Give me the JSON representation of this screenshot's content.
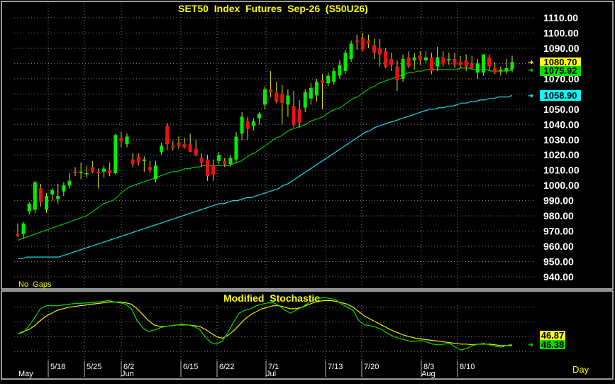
{
  "colors": {
    "background": "#000000",
    "grid": "#808080",
    "axis_text": "#ffffff",
    "title": "#ffff00",
    "up_candle": "#00ee00",
    "down_candle": "#ee1111",
    "ma_short": "#00c000",
    "ma_long": "#20d8e8",
    "stoch_k": "#00dd00",
    "stoch_d": "#eeee00",
    "last_price_tag": "#ffff00",
    "ma_short_tag": "#00dd00",
    "ma_long_tag": "#00ffff"
  },
  "chart_data": [
    {
      "type": "candlestick",
      "title": "SET50  Index  Futures  Sep-26  (S50U26)",
      "corner_note": "No  Gaps",
      "ylim": [
        934,
        1114
      ],
      "y_ticks": [
        940,
        950,
        960,
        970,
        980,
        990,
        1000,
        1010,
        1020,
        1030,
        1040,
        1050,
        1060,
        1070,
        1080,
        1090,
        1100,
        1110
      ],
      "y_tick_labels": [
        "940.00",
        "950.00",
        "960.00",
        "970.00",
        "980.00",
        "990.00",
        "1000.00",
        "1010.00",
        "1020.00",
        "1030.00",
        "1040.00",
        "1050.00",
        "1060.00",
        "1070.00",
        "1080.00",
        "1090.00",
        "1100.00",
        "1110.00"
      ],
      "candles": [
        [
          968,
          975,
          966,
          967
        ],
        [
          968,
          976,
          965,
          975
        ],
        [
          983,
          989,
          981,
          988
        ],
        [
          984,
          1003,
          982,
          1002
        ],
        [
          998,
          1001,
          986,
          989
        ],
        [
          984,
          995,
          982,
          993
        ],
        [
          994,
          998,
          990,
          997
        ],
        [
          991,
          1001,
          988,
          993
        ],
        [
          996,
          1002,
          993,
          1000
        ],
        [
          1000,
          1008,
          998,
          1003
        ],
        [
          1009,
          1012,
          1006,
          1008
        ],
        [
          1008,
          1015,
          1004,
          1009
        ],
        [
          1008,
          1013,
          1005,
          1008
        ],
        [
          1012,
          1016,
          1008,
          1009
        ],
        [
          1009,
          1011,
          998,
          1008
        ],
        [
          1009,
          1013,
          1005,
          1011
        ],
        [
          1010,
          1015,
          1006,
          1008
        ],
        [
          1008,
          1034,
          1007,
          1033
        ],
        [
          1031,
          1035,
          1025,
          1029
        ],
        [
          1027,
          1034,
          1025,
          1032
        ],
        [
          1017,
          1021,
          1012,
          1014
        ],
        [
          1019,
          1021,
          1013,
          1015
        ],
        [
          1016,
          1019,
          1009,
          1017
        ],
        [
          1012,
          1016,
          1008,
          1010
        ],
        [
          1004,
          1016,
          1002,
          1013
        ],
        [
          1022,
          1028,
          1020,
          1026
        ],
        [
          1039,
          1041,
          1023,
          1027
        ],
        [
          1026,
          1029,
          1023,
          1025
        ],
        [
          1028,
          1032,
          1024,
          1026
        ],
        [
          1027,
          1031,
          1024,
          1025
        ],
        [
          1027,
          1034,
          1022,
          1022
        ],
        [
          1024,
          1030,
          1019,
          1020
        ],
        [
          1018,
          1021,
          1012,
          1015
        ],
        [
          1017,
          1020,
          1003,
          1006
        ],
        [
          1013,
          1017,
          1003,
          1007
        ],
        [
          1016,
          1022,
          1014,
          1020
        ],
        [
          1016,
          1018,
          1012,
          1014
        ],
        [
          1014,
          1020,
          1012,
          1018
        ],
        [
          1017,
          1035,
          1015,
          1032
        ],
        [
          1034,
          1048,
          1030,
          1045
        ],
        [
          1042,
          1045,
          1030,
          1037
        ],
        [
          1039,
          1044,
          1036,
          1042
        ],
        [
          1044,
          1048,
          1040,
          1047
        ],
        [
          1053,
          1065,
          1050,
          1063
        ],
        [
          1063,
          1075,
          1058,
          1061
        ],
        [
          1061,
          1068,
          1054,
          1055
        ],
        [
          1060,
          1066,
          1040,
          1054
        ],
        [
          1053,
          1063,
          1045,
          1059
        ],
        [
          1052,
          1062,
          1038,
          1040
        ],
        [
          1050,
          1056,
          1038,
          1041
        ],
        [
          1051,
          1063,
          1048,
          1061
        ],
        [
          1057,
          1067,
          1053,
          1064
        ],
        [
          1059,
          1070,
          1055,
          1068
        ],
        [
          1069,
          1073,
          1050,
          1067
        ],
        [
          1067,
          1074,
          1065,
          1072
        ],
        [
          1068,
          1077,
          1066,
          1075
        ],
        [
          1072,
          1082,
          1070,
          1079
        ],
        [
          1075,
          1089,
          1073,
          1087
        ],
        [
          1083,
          1095,
          1081,
          1093
        ],
        [
          1095,
          1099,
          1089,
          1094
        ],
        [
          1097,
          1100,
          1088,
          1089
        ],
        [
          1095,
          1099,
          1090,
          1093
        ],
        [
          1092,
          1096,
          1083,
          1087
        ],
        [
          1090,
          1096,
          1078,
          1086
        ],
        [
          1088,
          1090,
          1077,
          1078
        ],
        [
          1083,
          1087,
          1075,
          1079
        ],
        [
          1078,
          1082,
          1062,
          1069
        ],
        [
          1070,
          1086,
          1068,
          1083
        ],
        [
          1084,
          1088,
          1077,
          1078
        ],
        [
          1082,
          1087,
          1076,
          1084
        ],
        [
          1085,
          1088,
          1079,
          1082
        ],
        [
          1082,
          1088,
          1080,
          1084
        ],
        [
          1084,
          1087,
          1073,
          1075
        ],
        [
          1078,
          1091,
          1075,
          1084
        ],
        [
          1084,
          1088,
          1078,
          1080
        ],
        [
          1082,
          1087,
          1079,
          1083
        ],
        [
          1083,
          1087,
          1077,
          1079
        ],
        [
          1081,
          1085,
          1077,
          1079
        ],
        [
          1082,
          1086,
          1075,
          1078
        ],
        [
          1080,
          1085,
          1076,
          1077
        ],
        [
          1074,
          1083,
          1070,
          1080
        ],
        [
          1074,
          1086,
          1072,
          1086
        ],
        [
          1084,
          1086,
          1075,
          1078
        ],
        [
          1077,
          1081,
          1073,
          1074
        ],
        [
          1075,
          1078,
          1072,
          1076
        ],
        [
          1075,
          1083,
          1073,
          1077
        ],
        [
          1076,
          1085,
          1074,
          1081
        ]
      ],
      "ma_short": [
        964,
        965,
        966,
        967,
        968,
        969,
        970,
        971,
        972,
        973,
        974,
        975,
        976,
        977,
        978,
        979,
        980,
        982,
        984,
        986,
        988,
        989,
        990,
        992,
        995,
        997,
        999,
        1000,
        1001,
        1002,
        1003,
        1004,
        1005,
        1006,
        1007,
        1008,
        1009,
        1009,
        1010,
        1011,
        1011,
        1012,
        1012,
        1013,
        1013,
        1013,
        1013,
        1013,
        1013,
        1013,
        1014,
        1015,
        1016,
        1018,
        1020,
        1021,
        1023,
        1025,
        1027,
        1029,
        1031,
        1032,
        1034,
        1036,
        1037,
        1038,
        1039,
        1040,
        1042,
        1043,
        1044,
        1045,
        1047,
        1049,
        1050,
        1051,
        1053,
        1055,
        1057,
        1058,
        1060,
        1062,
        1064,
        1065,
        1067,
        1068,
        1069,
        1070,
        1071,
        1072,
        1073,
        1074,
        1074,
        1075,
        1075,
        1076,
        1076,
        1076,
        1076,
        1076,
        1076,
        1076,
        1076,
        1077,
        1077,
        1077,
        1076,
        1076,
        1076,
        1076,
        1075,
        1075,
        1075,
        1075,
        1075,
        1076
      ],
      "ma_long": [
        952,
        952,
        953,
        953,
        953,
        953,
        953,
        953,
        953,
        953,
        954,
        955,
        956,
        957,
        958,
        959,
        960,
        961,
        962,
        963,
        964,
        965,
        966,
        967,
        968,
        969,
        970,
        971,
        972,
        973,
        974,
        975,
        976,
        977,
        978,
        979,
        980,
        981,
        982,
        983,
        984,
        985,
        986,
        987,
        988,
        988,
        989,
        990,
        990,
        991,
        992,
        992,
        993,
        994,
        995,
        996,
        997,
        998,
        1000,
        1001,
        1003,
        1005,
        1007,
        1009,
        1011,
        1013,
        1015,
        1017,
        1019,
        1021,
        1023,
        1025,
        1027,
        1029,
        1031,
        1033,
        1035,
        1036,
        1038,
        1039,
        1040,
        1041,
        1042,
        1043,
        1044,
        1045,
        1046,
        1047,
        1048,
        1049,
        1050,
        1050,
        1051,
        1051,
        1052,
        1052,
        1053,
        1054,
        1054,
        1055,
        1055,
        1056,
        1056,
        1057,
        1057,
        1058,
        1058,
        1058,
        1059
      ],
      "last_price": "1080.70",
      "ma_short_last": "1075.92",
      "ma_long_last": "1058.90"
    },
    {
      "type": "line",
      "title": "Modified  Stochastic",
      "ylim": [
        0,
        100
      ],
      "series": [
        {
          "key": "k",
          "values": [
            44,
            46,
            55,
            66,
            78,
            82,
            82,
            82,
            83,
            84,
            85,
            85,
            86,
            86,
            87,
            88,
            89,
            87,
            86,
            84,
            78,
            62,
            52,
            47,
            49,
            52,
            54,
            55,
            56,
            57,
            56,
            54,
            50,
            40,
            32,
            30,
            34,
            46,
            60,
            72,
            76,
            78,
            82,
            84,
            86,
            86,
            82,
            76,
            72,
            76,
            80,
            85,
            90,
            92,
            93,
            92,
            90,
            84,
            80,
            76,
            62,
            56,
            55,
            53,
            50,
            45,
            41,
            38,
            36,
            34,
            34,
            35,
            33,
            30,
            29,
            30,
            31,
            26,
            22,
            24,
            28,
            30,
            31,
            29,
            27,
            26,
            28,
            30
          ]
        },
        {
          "key": "d",
          "values": [
            44,
            47,
            50,
            55,
            62,
            68,
            72,
            76,
            78,
            80,
            81,
            82,
            83,
            84,
            85,
            86,
            87,
            87,
            87,
            86,
            84,
            78,
            70,
            62,
            56,
            54,
            54,
            55,
            56,
            56,
            56,
            55,
            54,
            50,
            45,
            40,
            38,
            42,
            48,
            56,
            64,
            70,
            74,
            78,
            80,
            82,
            82,
            80,
            78,
            78,
            80,
            83,
            86,
            88,
            89,
            89,
            88,
            86,
            84,
            80,
            74,
            68,
            64,
            60,
            56,
            52,
            48,
            45,
            42,
            40,
            38,
            37,
            36,
            35,
            34,
            33,
            32,
            31,
            30,
            30,
            29,
            30,
            30,
            30,
            29,
            28,
            28,
            28
          ]
        }
      ],
      "last_k": "46.38",
      "last_d": "46.87"
    }
  ],
  "x_axis": {
    "day_labels": [
      "5/18",
      "5/25",
      "6/2",
      "6/15",
      "6/22",
      "7/1",
      "7/13",
      "7/20",
      "8/3",
      "8/10"
    ],
    "month_labels": [
      "May",
      "Jun",
      "Jul",
      "Aug"
    ],
    "period": "Day"
  }
}
